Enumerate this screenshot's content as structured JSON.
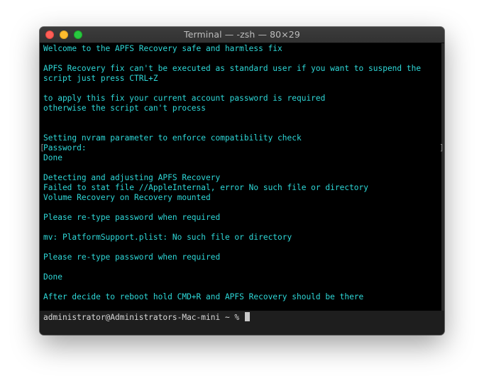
{
  "window": {
    "title": "Terminal — -zsh — 80×29"
  },
  "terminal": {
    "lines": [
      "Welcome to the APFS Recovery safe and harmless fix",
      "APFS Recovery fix can't be executed as standard user if you want to suspend the",
      "script just press CTRL+Z",
      "to apply this fix your current account password is required",
      "otherwise the script can't process",
      "Setting nvram parameter to enforce compatibility check",
      "Password:",
      "Done",
      "Detecting and adjusting APFS Recovery",
      "Failed to stat file //AppleInternal, error No such file or directory",
      "Volume Recovery on Recovery mounted",
      "Please re-type password when required",
      "mv: PlatformSupport.plist: No such file or directory",
      "Please re-type password when required",
      "Done",
      "After decide to reboot hold CMD+R and APFS Recovery should be there"
    ],
    "bracket_left": "[",
    "bracket_right": "]",
    "prompt": "administrator@Administrators-Mac-mini ~ % "
  },
  "colors": {
    "output_text": "#2ed8d8",
    "background": "#000000",
    "prompt_text": "#d8d8d8"
  }
}
